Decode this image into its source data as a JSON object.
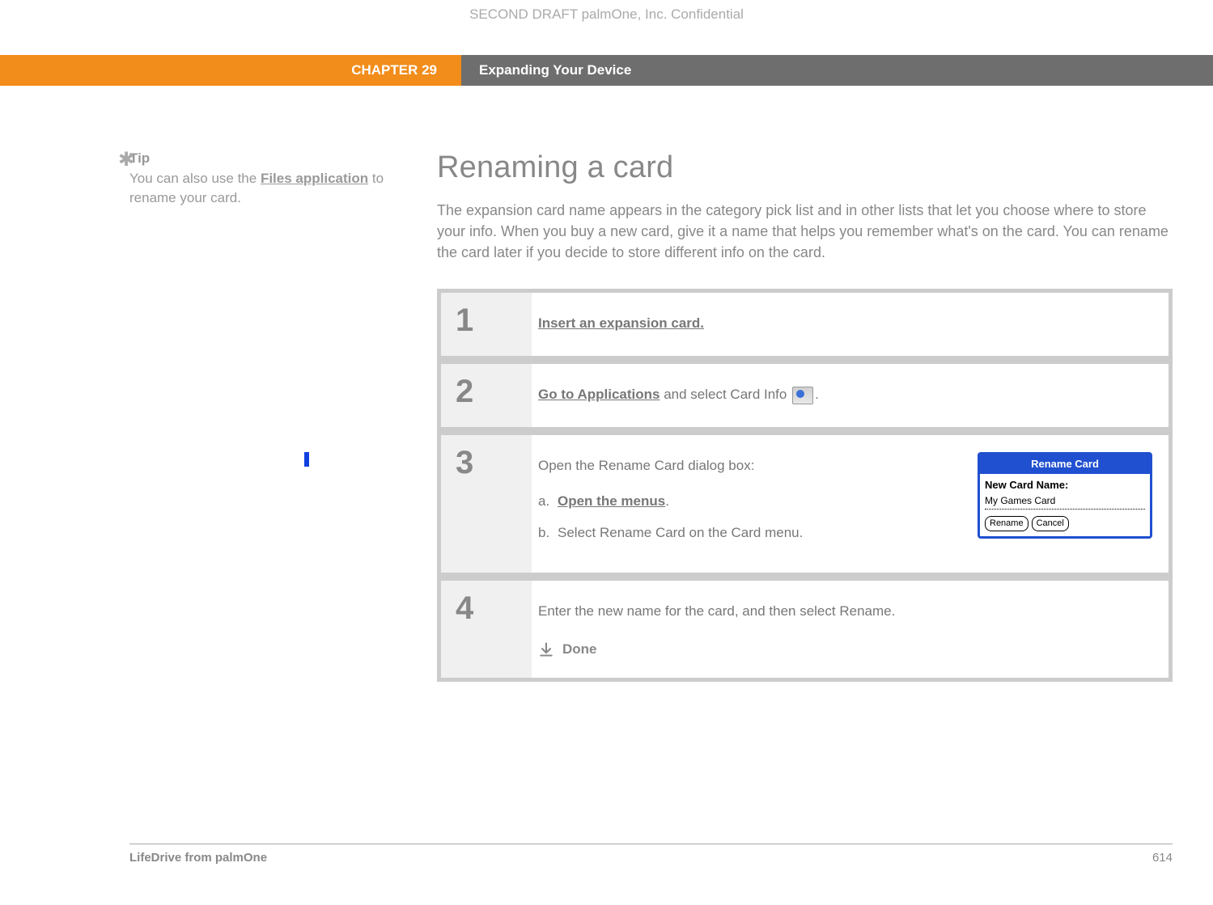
{
  "confidential": "SECOND DRAFT palmOne, Inc.  Confidential",
  "chapter_label": "CHAPTER 29",
  "chapter_title": "Expanding Your Device",
  "tip": {
    "label": "Tip",
    "pre": "You can also use the ",
    "link": "Files application",
    "post": " to rename your card."
  },
  "heading": "Renaming a card",
  "intro": "The expansion card name appears in the category pick list and in other lists that let you choose where to store your info. When you buy a new card, give it a name that helps you remember what's on the card. You can rename the card later if you decide to store different info on the card.",
  "steps": {
    "s1": {
      "num": "1",
      "link": "Insert an expansion card."
    },
    "s2": {
      "num": "2",
      "link": "Go to Applications",
      "post": " and select Card Info ",
      "tail": "."
    },
    "s3": {
      "num": "3",
      "lead": "Open the Rename Card dialog box:",
      "a_letter": "a.",
      "a_link": "Open the menus",
      "a_tail": ".",
      "b_letter": "b.",
      "b_text": "Select Rename Card on the Card menu."
    },
    "s4": {
      "num": "4",
      "text": "Enter the new name for the card, and then select Rename.",
      "done": "Done"
    }
  },
  "dialog": {
    "title": "Rename Card",
    "label": "New Card Name:",
    "value": "My Games Card",
    "btn_rename": "Rename",
    "btn_cancel": "Cancel"
  },
  "footer": {
    "product": "LifeDrive from palmOne",
    "page": "614"
  }
}
